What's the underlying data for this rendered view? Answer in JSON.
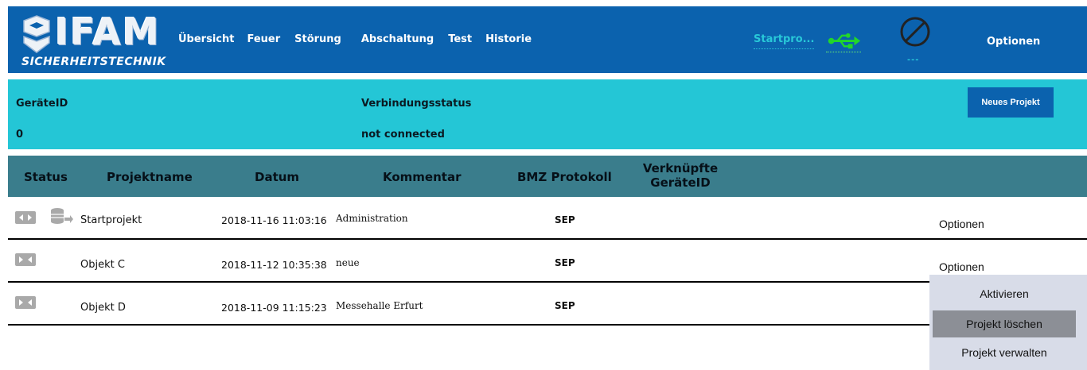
{
  "brand": {
    "name": "IFAM",
    "subtitle": "SICHERHEITSTECHNIK"
  },
  "nav": {
    "items": [
      "Übersicht",
      "Feuer",
      "Störung",
      "Abschaltung",
      "Test",
      "Historie"
    ],
    "project_link": "Startpro...",
    "status_sub": "---",
    "options": "Optionen"
  },
  "info": {
    "device_id_label": "GeräteID",
    "device_id_value": "0",
    "connection_label": "Verbindungsstatus",
    "connection_value": "not connected",
    "new_project_button": "Neues Projekt"
  },
  "table": {
    "headers": {
      "status": "Status",
      "name": "Projektname",
      "date": "Datum",
      "comment": "Kommentar",
      "protocol": "BMZ Protokoll",
      "linked_line1": "Verknüpfte",
      "linked_line2": "GeräteID"
    },
    "rows": [
      {
        "name": "Startprojekt",
        "date": "2018-11-16 11:03:16",
        "comment": "Administration",
        "protocol": "SEP",
        "options": "Optionen"
      },
      {
        "name": "Objekt C",
        "date": "2018-11-12 10:35:38",
        "comment": "neue",
        "protocol": "SEP",
        "options": "Optionen"
      },
      {
        "name": "Objekt D",
        "date": "2018-11-09 11:15:23",
        "comment": "Messehalle Erfurt",
        "protocol": "SEP",
        "options": ""
      }
    ]
  },
  "menu": {
    "items": [
      "Aktivieren",
      "Projekt löschen",
      "Projekt verwalten"
    ],
    "highlighted": "Projekt löschen"
  },
  "colors": {
    "header": "#0b62ae",
    "info_bar": "#24c6d6",
    "table_header": "#3a7d8c",
    "usb_icon": "#22d62a",
    "menu_bg": "#d8dce8",
    "menu_highlight": "#8c8f96"
  },
  "icons": {
    "logo": "ifam-shield-logo",
    "usb": "usb-icon",
    "ban": "disconnected-icon",
    "row_status": "connect-arrows-icon",
    "row_db": "database-export-icon"
  }
}
